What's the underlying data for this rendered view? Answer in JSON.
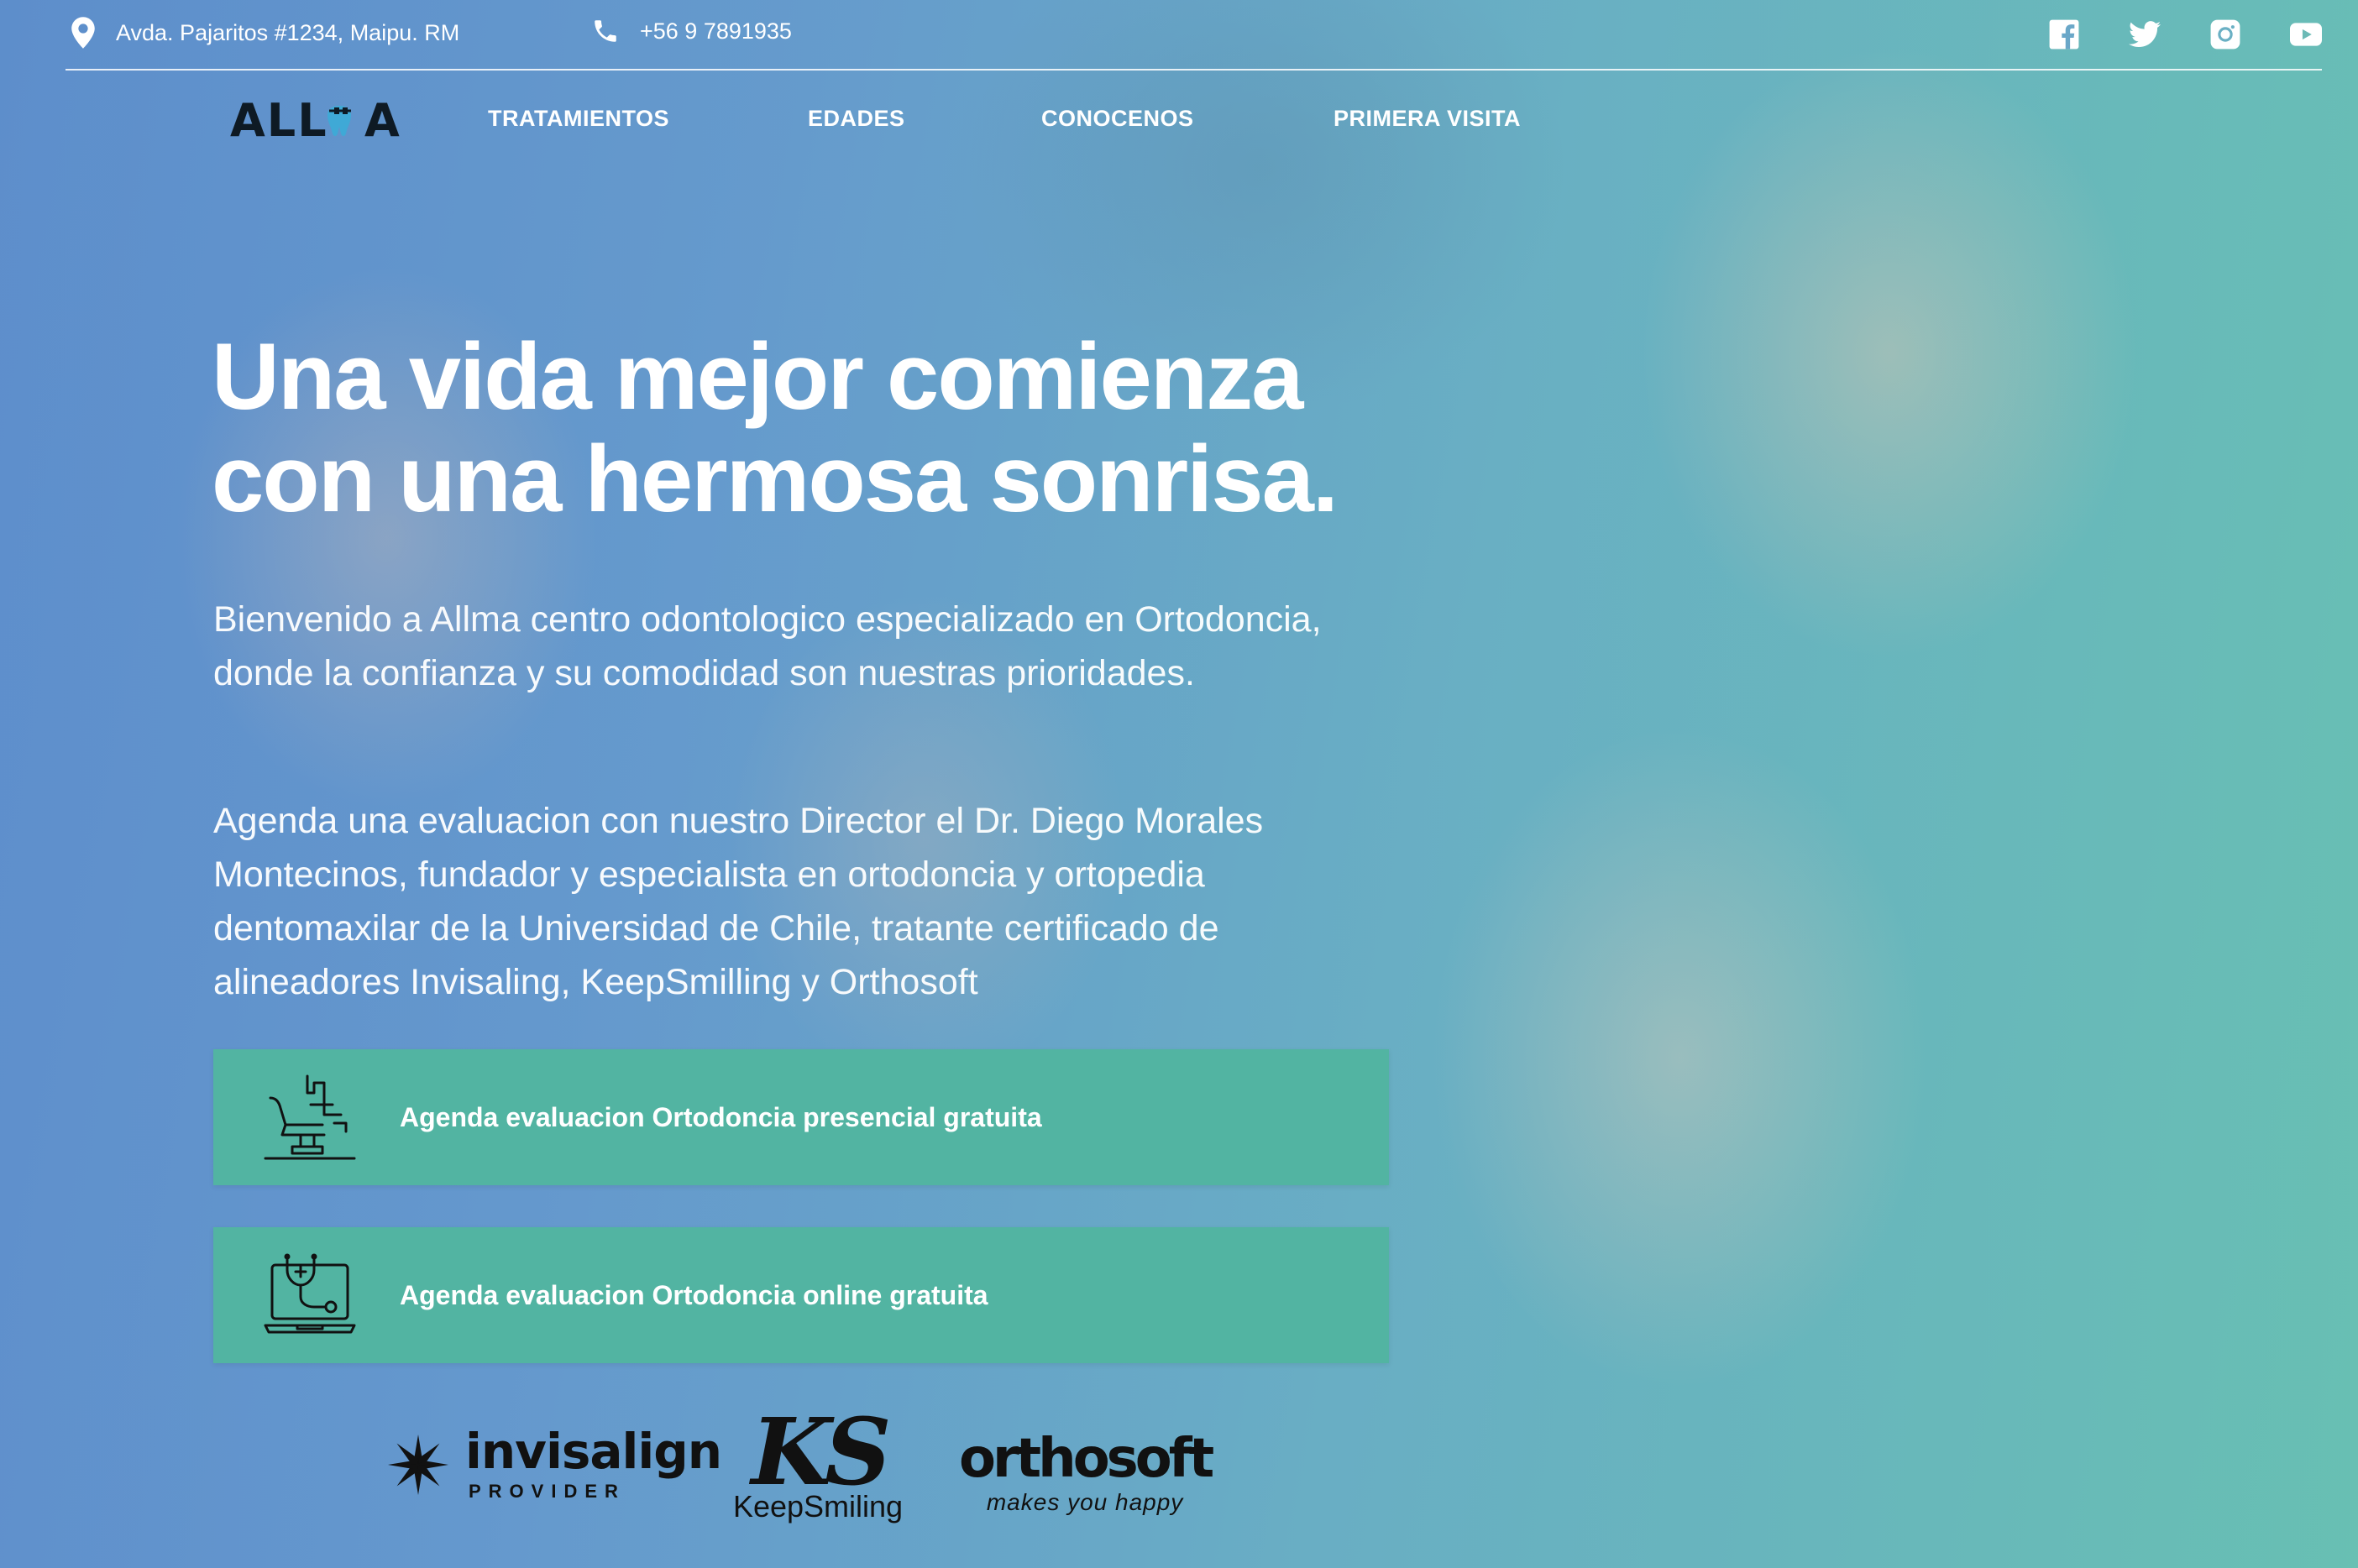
{
  "topbar": {
    "address": "Avda. Pajaritos #1234, Maipu. RM",
    "phone": "+56 9 7891935",
    "social": [
      "facebook-icon",
      "twitter-icon",
      "instagram-icon",
      "youtube-icon"
    ]
  },
  "logo": {
    "text": "ALLMA"
  },
  "nav": {
    "items": [
      {
        "label": "TRATAMIENTOS"
      },
      {
        "label": "EDADES"
      },
      {
        "label": "CONOCENOS"
      },
      {
        "label": "PRIMERA VISITA"
      }
    ]
  },
  "hero": {
    "headline_line1": "Una vida mejor comienza",
    "headline_line2": "con una hermosa sonrisa.",
    "paragraph1": "Bienvenido a Allma centro odontologico especializado en Ortodoncia, donde la confianza y su comodidad son nuestras prioridades.",
    "paragraph2": "Agenda una evaluacion con nuestro Director el Dr. Diego Morales Montecinos, fundador y especialista en ortodoncia y ortopedia dentomaxilar de la Universidad de Chile, tratante certificado de alineadores Invisaling, KeepSmilling y Orthosoft"
  },
  "cta": {
    "presencial": {
      "label": "Agenda evaluacion Ortodoncia presencial gratuita",
      "icon": "dental-chair-icon"
    },
    "online": {
      "label": "Agenda evaluacion Ortodoncia online gratuita",
      "icon": "online-consult-icon"
    }
  },
  "partners": {
    "invisalign": {
      "name": "invisalign",
      "sub": "PROVIDER"
    },
    "keepsmiling": {
      "mark": "KS",
      "name": "KeepSmiling"
    },
    "orthosoft": {
      "name": "orthosoft",
      "sub": "makes you happy"
    }
  },
  "colors": {
    "cta_bg": "#52b4a2",
    "text": "#ffffff",
    "logo_accent": "#3fa9d6"
  }
}
